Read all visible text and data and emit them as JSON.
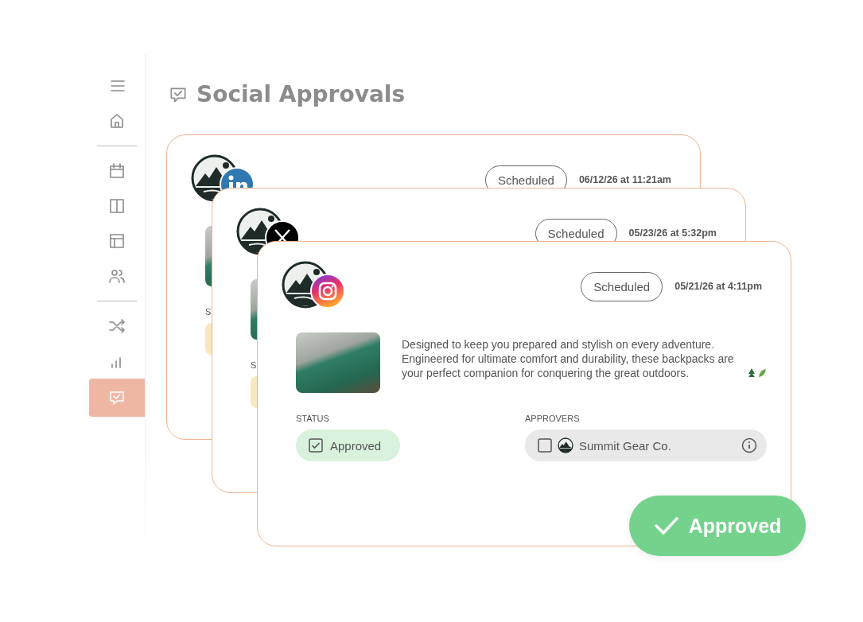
{
  "page_title": "Social Approvals",
  "sidebar": {
    "groups": [
      [
        {
          "selected": false
        },
        {
          "selected": false
        }
      ],
      [
        {
          "selected": false
        },
        {
          "selected": false
        },
        {
          "selected": false
        },
        {
          "selected": false
        }
      ],
      [
        {
          "selected": false
        },
        {
          "selected": false
        },
        {
          "selected": true
        }
      ]
    ]
  },
  "cards": [
    {
      "kind": "linkedin",
      "badge": "Scheduled",
      "date": "06/12/26 at 11:21am",
      "status": {
        "label": "S",
        "color": "#f8e8bd"
      }
    },
    {
      "kind": "x",
      "badge": "Scheduled",
      "date": "05/23/26 at 5:32pm",
      "status": {
        "label": "S",
        "color": "#f8e8bd"
      }
    },
    {
      "kind": "instagram",
      "badge": "Scheduled",
      "date": "05/21/26 at 4:11pm",
      "description": "Designed to keep you prepared and stylish on every adventure. Engineered for ultimate comfort and durability, these backpacks are your perfect companion for conquering the great outdoors.",
      "status": {
        "label": "STATUS",
        "value": "Approved",
        "checked": true,
        "color": "#d8f2dd"
      },
      "approvers": {
        "label": "APPROVERS",
        "name": "Summit Gear Co.",
        "checked": false
      }
    }
  ],
  "toast": {
    "label": "Approved"
  }
}
